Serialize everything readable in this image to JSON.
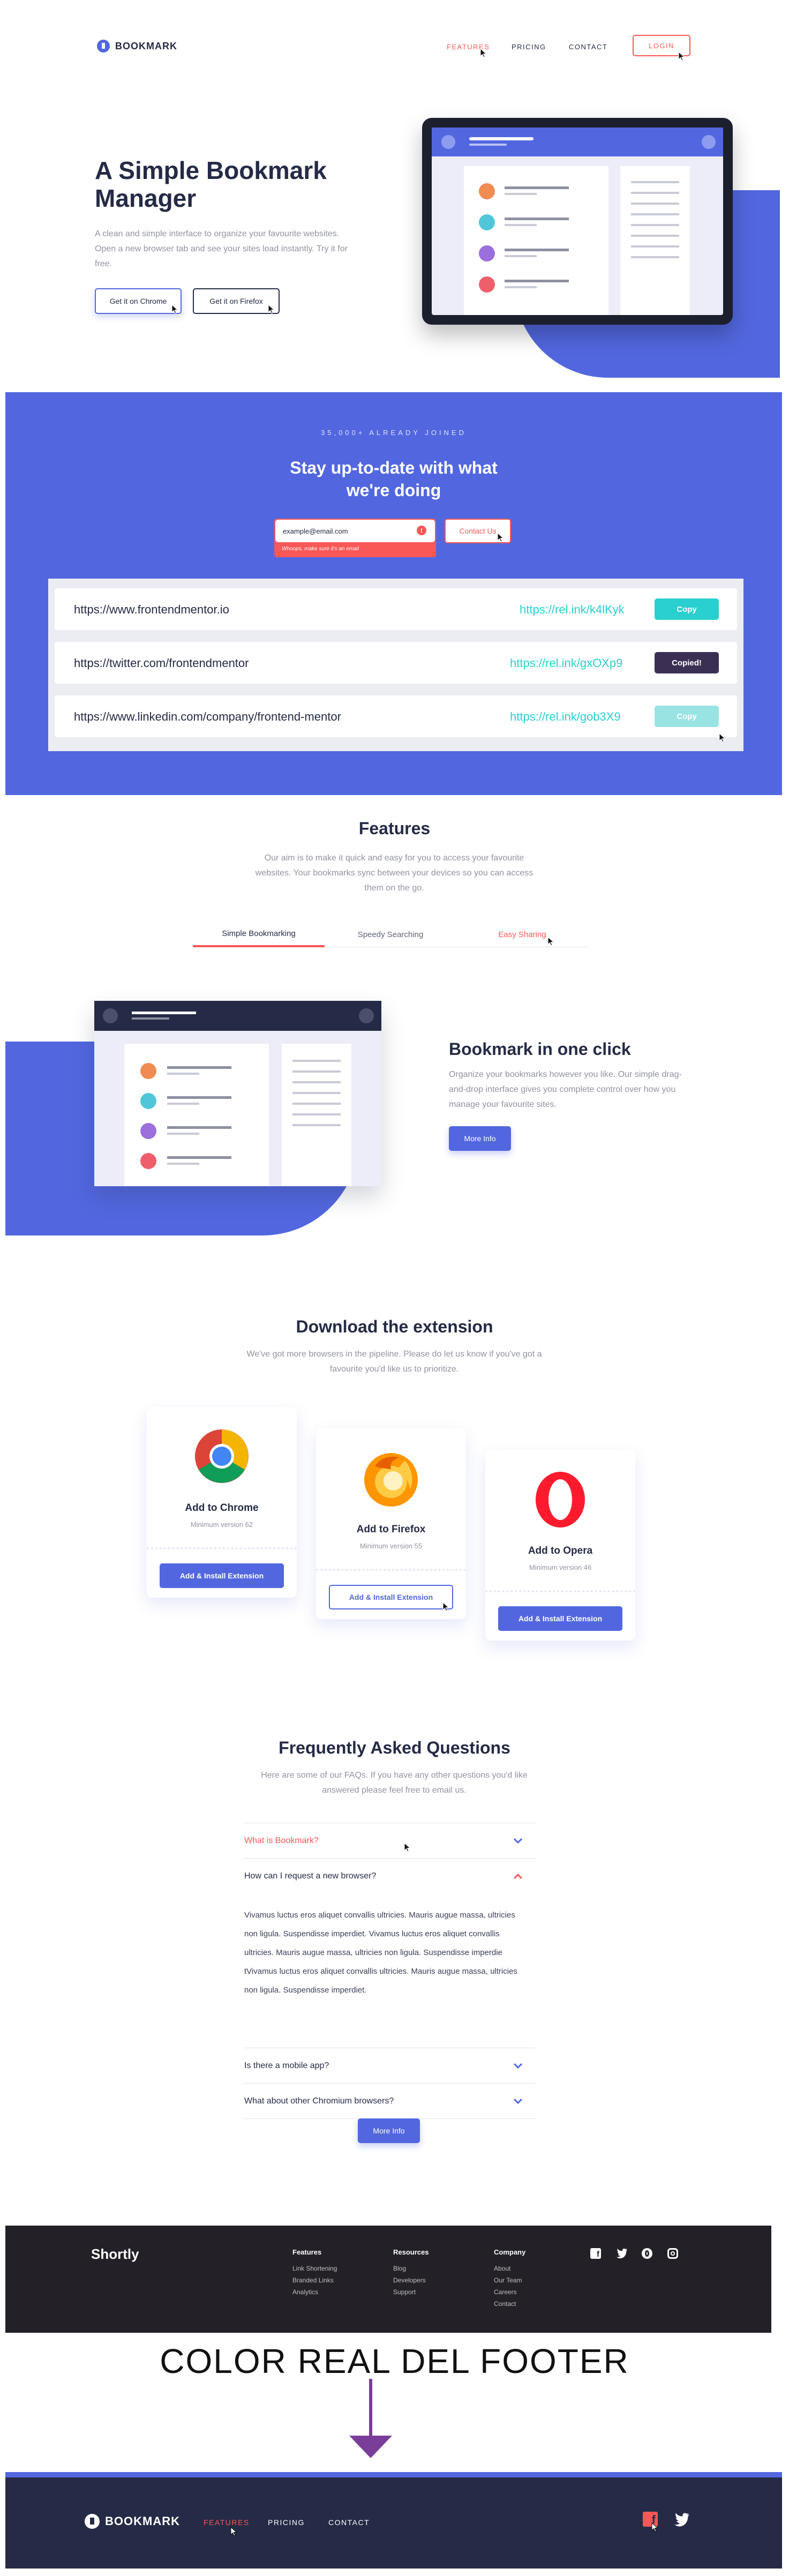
{
  "nav": {
    "brand": "BOOKMARK",
    "links": [
      "FEATURES",
      "PRICING",
      "CONTACT"
    ],
    "login": "LOGIN"
  },
  "hero": {
    "title_line1": "A Simple Bookmark",
    "title_line2": "Manager",
    "description": "A clean and simple interface to organize your favourite websites. Open a new browser tab and see your sites load instantly. Try it for free.",
    "btn_chrome": "Get it on Chrome",
    "btn_firefox": "Get it on Firefox"
  },
  "signup": {
    "eyebrow": "35,000+ ALREADY JOINED",
    "title_line1": "Stay up-to-date with what",
    "title_line2": "we're doing",
    "email_value": "example@email.com",
    "error_text": "Whoops, make sure it's an email",
    "contact_btn": "Contact Us"
  },
  "links": [
    {
      "original": "https://www.frontendmentor.io",
      "short": "https://rel.ink/k4lKyk",
      "action": "Copy"
    },
    {
      "original": "https://twitter.com/frontendmentor",
      "short": "https://rel.ink/gxOXp9",
      "action": "Copied!"
    },
    {
      "original": "https://www.linkedin.com/company/frontend-mentor",
      "short": "https://rel.ink/gob3X9",
      "action": "Copy"
    }
  ],
  "features": {
    "title": "Features",
    "description": "Our aim is to make it quick and easy for you to access your favourite websites. Your bookmarks sync between your devices so you can access them on the go.",
    "tabs": [
      "Simple Bookmarking",
      "Speedy Searching",
      "Easy Sharing"
    ],
    "panel_title": "Bookmark in one click",
    "panel_text": "Organize your bookmarks however you like. Our simple drag-and-drop interface gives you complete control over how you manage your favourite sites.",
    "panel_btn": "More Info"
  },
  "extension": {
    "title": "Download the extension",
    "description": "We've got more browsers in the pipeline. Please do let us know if you've got a favourite you'd like us to prioritize.",
    "cards": [
      {
        "name": "Add to Chrome",
        "version": "Minimum version 62",
        "btn": "Add & Install Extension"
      },
      {
        "name": "Add to Firefox",
        "version": "Minimum version 55",
        "btn": "Add & Install Extension"
      },
      {
        "name": "Add to Opera",
        "version": "Minimum version 46",
        "btn": "Add & Install Extension"
      }
    ]
  },
  "faq": {
    "title": "Frequently Asked Questions",
    "description": "Here are some of our FAQs. If you have any other questions you'd like answered please feel free to email us.",
    "items": [
      {
        "q": "What is Bookmark?"
      },
      {
        "q": "How can I request a new browser?",
        "a": "Vivamus luctus eros aliquet convallis ultricies. Mauris augue massa, ultricies non ligula. Suspendisse imperdiet. Vivamus luctus eros aliquet convallis ultricies. Mauris augue massa, ultricies non ligula. Suspendisse imperdie tVivamus luctus eros aliquet convallis ultricies. Mauris augue massa, ultricies non ligula. Suspendisse imperdiet."
      },
      {
        "q": "Is there a mobile app?"
      },
      {
        "q": "What about other Chromium browsers?"
      }
    ],
    "btn": "More Info"
  },
  "footer_old": {
    "brand": "Shortly",
    "cols": [
      {
        "title": "Features",
        "items": [
          "Link Shortening",
          "Branded Links",
          "Analytics"
        ]
      },
      {
        "title": "Resources",
        "items": [
          "Blog",
          "Developers",
          "Support"
        ]
      },
      {
        "title": "Company",
        "items": [
          "About",
          "Our Team",
          "Careers",
          "Contact"
        ]
      }
    ]
  },
  "annotation": "COLOR REAL DEL FOOTER",
  "footer": {
    "brand": "BOOKMARK",
    "links": [
      "FEATURES",
      "PRICING",
      "CONTACT"
    ]
  },
  "colors": {
    "blue": "#5267df",
    "red": "#fa5757",
    "navy": "#252b46",
    "cyan": "#2acfcf",
    "purple": "#7a3e98"
  }
}
